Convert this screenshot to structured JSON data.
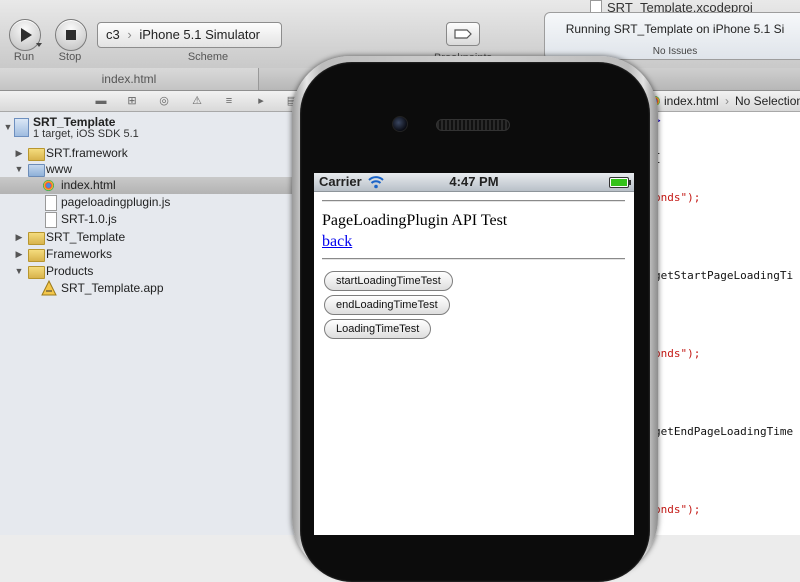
{
  "window": {
    "title": "SRT_Template.xcodeproj"
  },
  "toolbar": {
    "run_label": "Run",
    "stop_label": "Stop",
    "scheme_label": "Scheme",
    "breakpoints_label": "Breakpoints",
    "scheme": {
      "project": "c3",
      "destination": "iPhone 5.1 Simulator"
    }
  },
  "activity": {
    "status": "Running SRT_Template on iPhone 5.1 Si",
    "issues": "No Issues"
  },
  "tabs": [
    {
      "label": "index.html"
    }
  ],
  "navigator": {
    "project": {
      "name": "SRT_Template",
      "subtitle": "1 target, iOS SDK 5.1"
    },
    "items": [
      {
        "label": "SRT.framework",
        "icon": "framework-icon"
      },
      {
        "label": "www",
        "icon": "folder-icon",
        "expanded": true
      },
      {
        "label": "index.html",
        "icon": "html-file-icon",
        "selected": true
      },
      {
        "label": "pageloadingplugin.js",
        "icon": "js-file-icon"
      },
      {
        "label": "SRT-1.0.js",
        "icon": "js-file-icon"
      },
      {
        "label": "SRT_Template",
        "icon": "folder-icon"
      },
      {
        "label": "Frameworks",
        "icon": "folder-icon"
      },
      {
        "label": "Products",
        "icon": "folder-icon",
        "expanded": true
      },
      {
        "label": "SRT_Template.app",
        "icon": "app-icon"
      }
    ]
  },
  "jumpbar": {
    "file": "index.html",
    "selection": "No Selection"
  },
  "editor": {
    "lines": [
      {
        "text": ">",
        "kind": "plain"
      },
      {
        "text": "{",
        "kind": "plain"
      },
      {
        "text": "onds\");",
        "kind": "string"
      },
      {
        "text": "getStartPageLoadingTi",
        "kind": "plain"
      },
      {
        "text": "onds\");",
        "kind": "string"
      },
      {
        "text": "getEndPageLoadingTime",
        "kind": "plain"
      },
      {
        "text": "onds\");",
        "kind": "string"
      }
    ]
  },
  "simulator": {
    "statusbar": {
      "carrier": "Carrier",
      "time": "4:47 PM"
    },
    "page": {
      "title": "PageLoadingPlugin API Test",
      "link": "back",
      "buttons": [
        {
          "label": "startLoadingTimeTest"
        },
        {
          "label": "endLoadingTimeTest"
        },
        {
          "label": "LoadingTimeTest"
        }
      ]
    }
  },
  "colors": {
    "link": "#0000ee",
    "selection": "#bcbcbc",
    "string": "#c41a16",
    "battery": "#34c21a"
  }
}
